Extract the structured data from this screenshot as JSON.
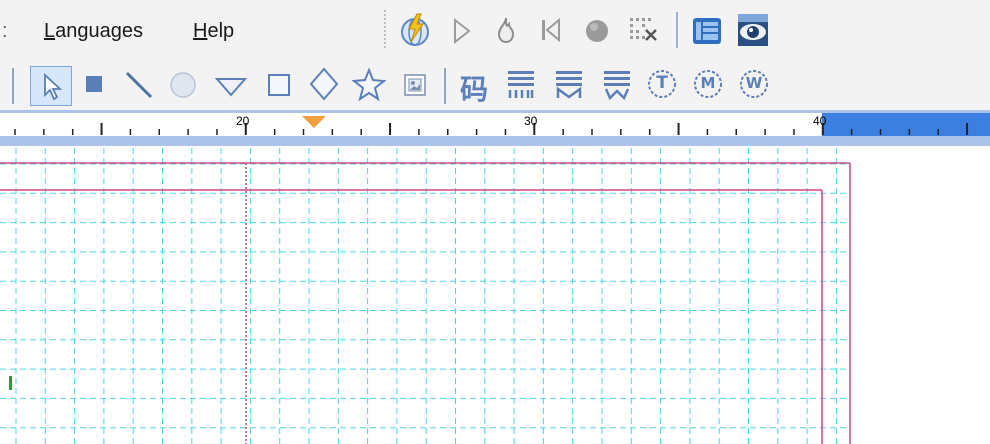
{
  "menu": {
    "languages": {
      "accel": "L",
      "rest": "anguages"
    },
    "help": {
      "accel": "H",
      "rest": "elp"
    },
    "truncated_glyph": ":"
  },
  "toolbar_top": {
    "icons": [
      "lightning-globe-icon",
      "play-icon",
      "flame-icon",
      "skip-back-icon",
      "record-icon",
      "grid-cancel-icon",
      "panel-icon",
      "eye-icon"
    ]
  },
  "toolbar_draw": {
    "icons": [
      "pointer-icon",
      "square-fill-icon",
      "line-icon",
      "circle-icon",
      "triangle-down-icon",
      "square-outline-icon",
      "diamond-icon",
      "star-icon",
      "image-icon",
      "barcode-char-icon",
      "text-bars-icon",
      "text-bars-m-icon",
      "text-bars-w-icon",
      "circle-t-icon",
      "circle-m-icon",
      "circle-w-icon"
    ],
    "glyph_char": "码",
    "circle_letters": [
      "T",
      "M",
      "W"
    ]
  },
  "ruler": {
    "labels": [
      "20",
      "30",
      "40"
    ]
  },
  "colors": {
    "grid": "#49d6e6",
    "margin": "#c74b8a",
    "ruler_highlight": "#3d7fe0",
    "ruler_band": "#a9c4e8",
    "marker": "#f0a040"
  }
}
